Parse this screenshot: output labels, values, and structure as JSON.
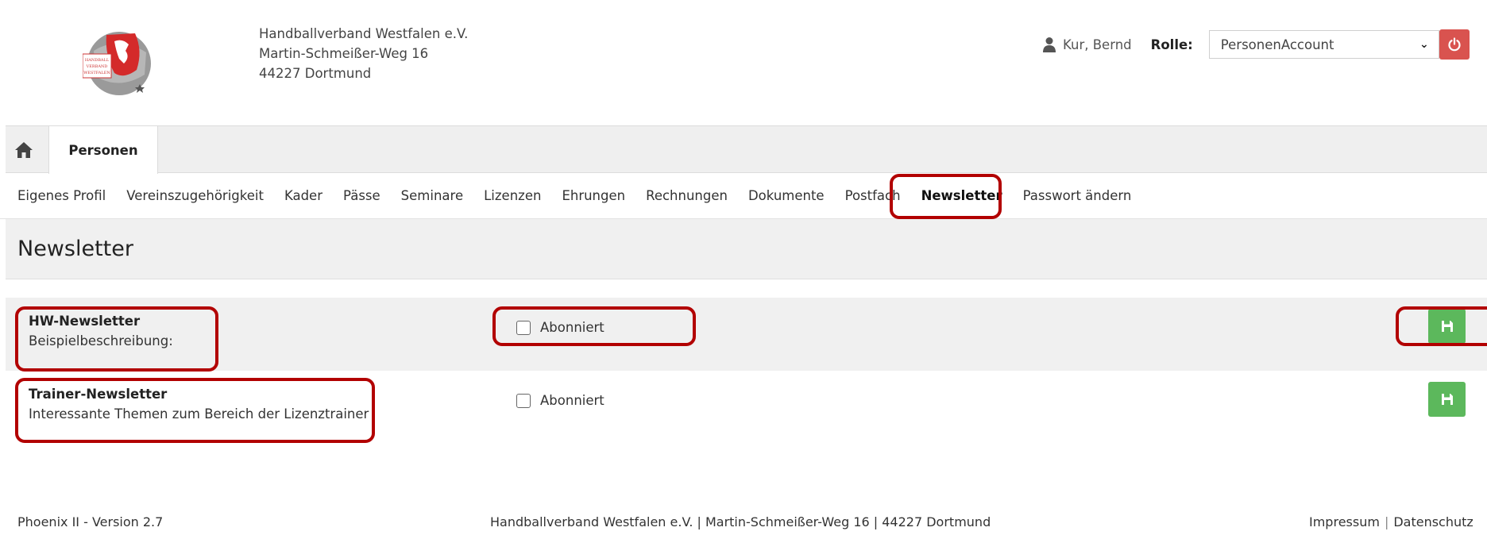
{
  "header": {
    "org_name": "Handballverband Westfalen e.V.",
    "street": "Martin-Schmeißer-Weg 16",
    "city": "44227 Dortmund",
    "logo_text": "HANDBALL VERBAND WESTFALEN",
    "user_icon": "user-icon",
    "user_name": "Kur, Bernd",
    "role_label": "Rolle:",
    "role_value": "PersonenAccount",
    "power_icon": "power-icon"
  },
  "tabs": {
    "home_icon": "home-icon",
    "active_tab": "Personen"
  },
  "subnav": {
    "items": [
      {
        "label": "Eigenes Profil"
      },
      {
        "label": "Vereinszugehörigkeit"
      },
      {
        "label": "Kader"
      },
      {
        "label": "Pässe"
      },
      {
        "label": "Seminare"
      },
      {
        "label": "Lizenzen"
      },
      {
        "label": "Ehrungen"
      },
      {
        "label": "Rechnungen"
      },
      {
        "label": "Dokumente"
      },
      {
        "label": "Postfach"
      },
      {
        "label": "Newsletter"
      },
      {
        "label": "Passwort ändern"
      }
    ],
    "active": "Newsletter"
  },
  "page": {
    "title": "Newsletter"
  },
  "newsletters": [
    {
      "title": "HW-Newsletter",
      "description": "Beispielbeschreibung:",
      "checkbox_label": "Abonniert",
      "checked": false,
      "save_icon": "save-icon"
    },
    {
      "title": "Trainer-Newsletter",
      "description": "Interessante Themen zum Bereich der Lizenztrainer",
      "checkbox_label": "Abonniert",
      "checked": false,
      "save_icon": "save-icon"
    }
  ],
  "footer": {
    "version": "Phoenix II - Version 2.7",
    "address": "Handballverband Westfalen e.V. | Martin-Schmeißer-Weg 16 | 44227 Dortmund",
    "impressum": "Impressum",
    "separator": "|",
    "datenschutz": "Datenschutz"
  },
  "colors": {
    "highlight": "#b20000",
    "save_button": "#5cb85c",
    "power_button": "#d9534f"
  }
}
